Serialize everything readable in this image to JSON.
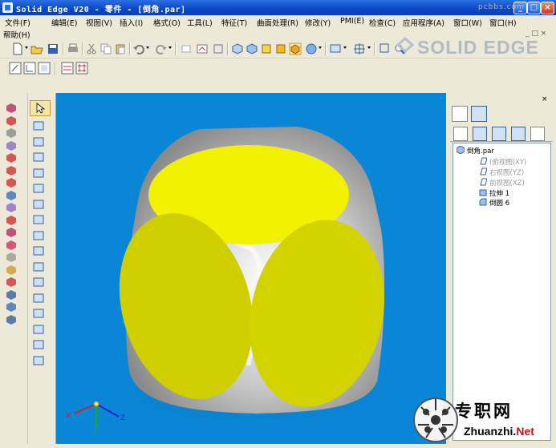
{
  "window": {
    "title": "Solid Edge V20 - 零件 - [倒角.par]",
    "minimize": "_",
    "maximize": "□",
    "close": "×"
  },
  "menu": {
    "row1": [
      "文件(F)",
      "编辑(E)",
      "视图(V)",
      "插入(I)",
      "格式(O)",
      "工具(L)",
      "特征(T)",
      "曲面处理(R)",
      "修改(Y)",
      "PMI(E)",
      "检查(C)",
      "应用程序(A)",
      "窗口(W)",
      "窗口(H)"
    ],
    "row2": [
      "帮助(H)"
    ]
  },
  "watermarks": {
    "logo": "SOLID EDGE",
    "site": "pcbbs.com"
  },
  "toolbar_icons": [
    "new-icon",
    "open-icon",
    "save-icon",
    "print-icon",
    "cut-icon",
    "copy-icon",
    "paste-icon",
    "undo-icon",
    "redo-icon",
    "zoom-icon",
    "fit-icon",
    "rotate-icon",
    "shaded-icon"
  ],
  "feature_tree": {
    "root": "倒角.par",
    "items": [
      {
        "label": "(俯视图(XY)",
        "dim": true
      },
      {
        "label": "右视图(YZ)",
        "dim": true
      },
      {
        "label": "前视图(XZ)",
        "dim": true
      },
      {
        "label": "拉伸 1",
        "dim": false
      },
      {
        "label": "倒圆 6",
        "dim": false
      }
    ]
  },
  "triad": {
    "x": "X",
    "y": "Y",
    "z": "Z"
  },
  "colors": {
    "viewport_bg": "#0a86d6",
    "face_yellow": "#f2f200",
    "face_side": "#cfcf00",
    "title_bar": "#0a46c8"
  },
  "branding": {
    "cn": "专职网",
    "url_main": "Zhuanzhi.",
    "url_tld": "Net"
  }
}
